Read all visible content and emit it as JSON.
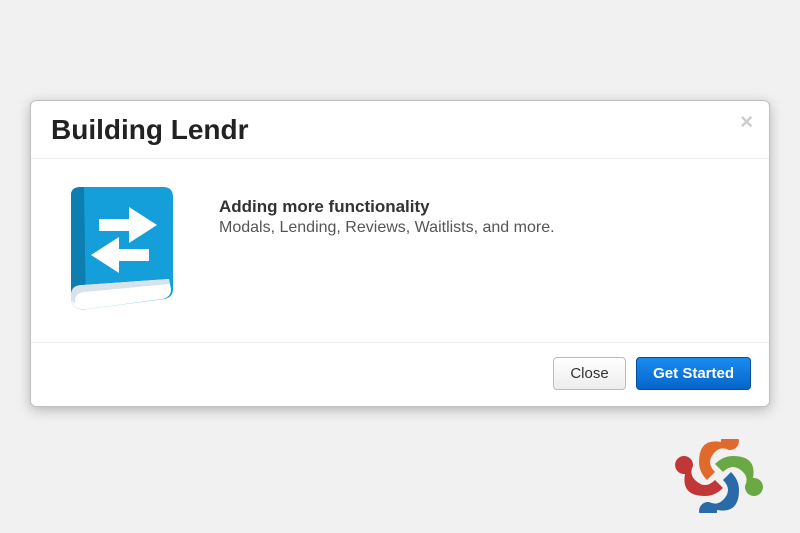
{
  "modal": {
    "title": "Building Lendr",
    "close_glyph": "×",
    "body": {
      "heading": "Adding more functionality",
      "subtext": "Modals, Lending, Reviews, Waitlists, and more."
    },
    "footer": {
      "close_label": "Close",
      "primary_label": "Get Started"
    }
  },
  "icons": {
    "book_color": "#159fda",
    "logo_name": "joomla-logo"
  }
}
